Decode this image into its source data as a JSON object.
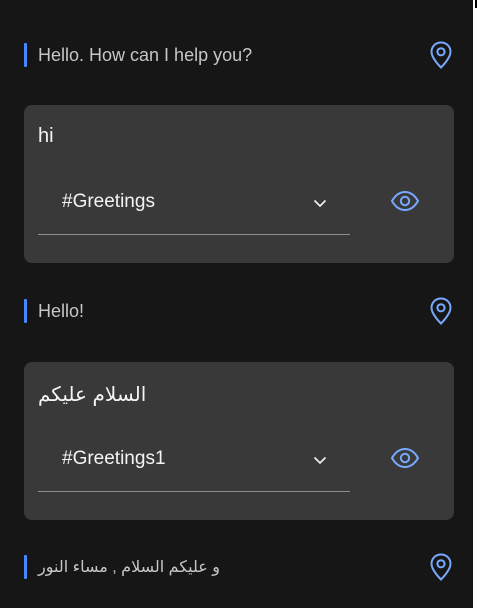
{
  "messages": {
    "bot_1": "Hello. How can I help you?",
    "user_1": {
      "text": "hi",
      "intent_value": "#Greetings"
    },
    "bot_2": "Hello!",
    "user_2": {
      "text": "السلام عليكم",
      "intent_value": "#Greetings1"
    },
    "bot_3": "و عليكم السلام , مساء النور"
  },
  "icons": {
    "pin": "location-pin-icon",
    "dropdown": "chevron-down-icon",
    "view": "eye-icon"
  },
  "colors": {
    "background": "#161616",
    "card": "#393939",
    "accent": "#4589ff",
    "icon": "#78a9ff",
    "bot_text": "#c6c6c6",
    "user_text": "#f4f4f4"
  }
}
